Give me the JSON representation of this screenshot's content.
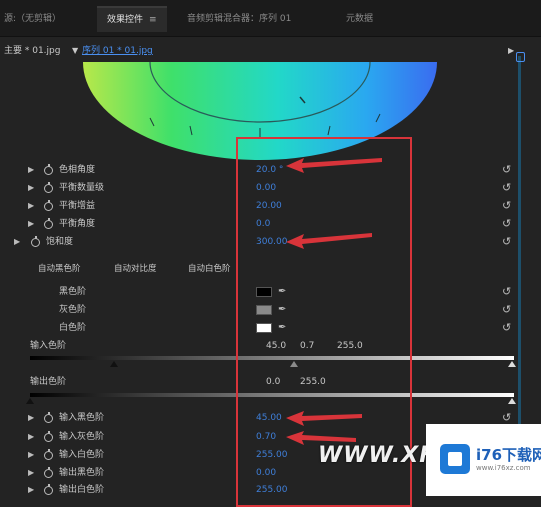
{
  "tabs": [
    {
      "label": "源:（无剪辑）",
      "active": false
    },
    {
      "label": "效果控件",
      "active": true
    },
    {
      "label": "音频剪辑混合器：序列 01",
      "active": false
    },
    {
      "label": "元数据",
      "active": false
    }
  ],
  "path": {
    "clip": "主要 * 01.jpg",
    "sequence": "序列 01 * 01.jpg"
  },
  "params": [
    {
      "label": "色相角度",
      "value": "20.0 °"
    },
    {
      "label": "平衡数量级",
      "value": "0.00"
    },
    {
      "label": "平衡增益",
      "value": "20.00"
    },
    {
      "label": "平衡角度",
      "value": "0.0"
    },
    {
      "label": "饱和度",
      "value": "300.00"
    }
  ],
  "auto_buttons": [
    "自动黑色阶",
    "自动对比度",
    "自动白色阶"
  ],
  "levels": [
    {
      "label": "黑色阶",
      "swatch": "#000000"
    },
    {
      "label": "灰色阶",
      "swatch": "#8a8a8a"
    },
    {
      "label": "白色阶",
      "swatch": "#ffffff"
    }
  ],
  "input_levels": {
    "label": "输入色阶",
    "values": [
      "45.0",
      "0.7",
      "255.0"
    ]
  },
  "output_levels": {
    "label": "输出色阶",
    "values": [
      "0.0",
      "255.0"
    ]
  },
  "lower_params": [
    {
      "label": "输入黑色阶",
      "value": "45.00"
    },
    {
      "label": "输入灰色阶",
      "value": "0.70"
    },
    {
      "label": "输入白色阶",
      "value": "255.00"
    },
    {
      "label": "输出黑色阶",
      "value": "0.00"
    },
    {
      "label": "输出白色阶",
      "value": "255.00"
    }
  ],
  "watermark": {
    "text": "WWW.XFDC",
    "logo_text": "i76下载网",
    "logo_sub": "www.i76xz.com"
  },
  "colors": {
    "accent_value": "#3f7fd9",
    "highlight": "#d8343a",
    "link": "#4a8ff0"
  }
}
